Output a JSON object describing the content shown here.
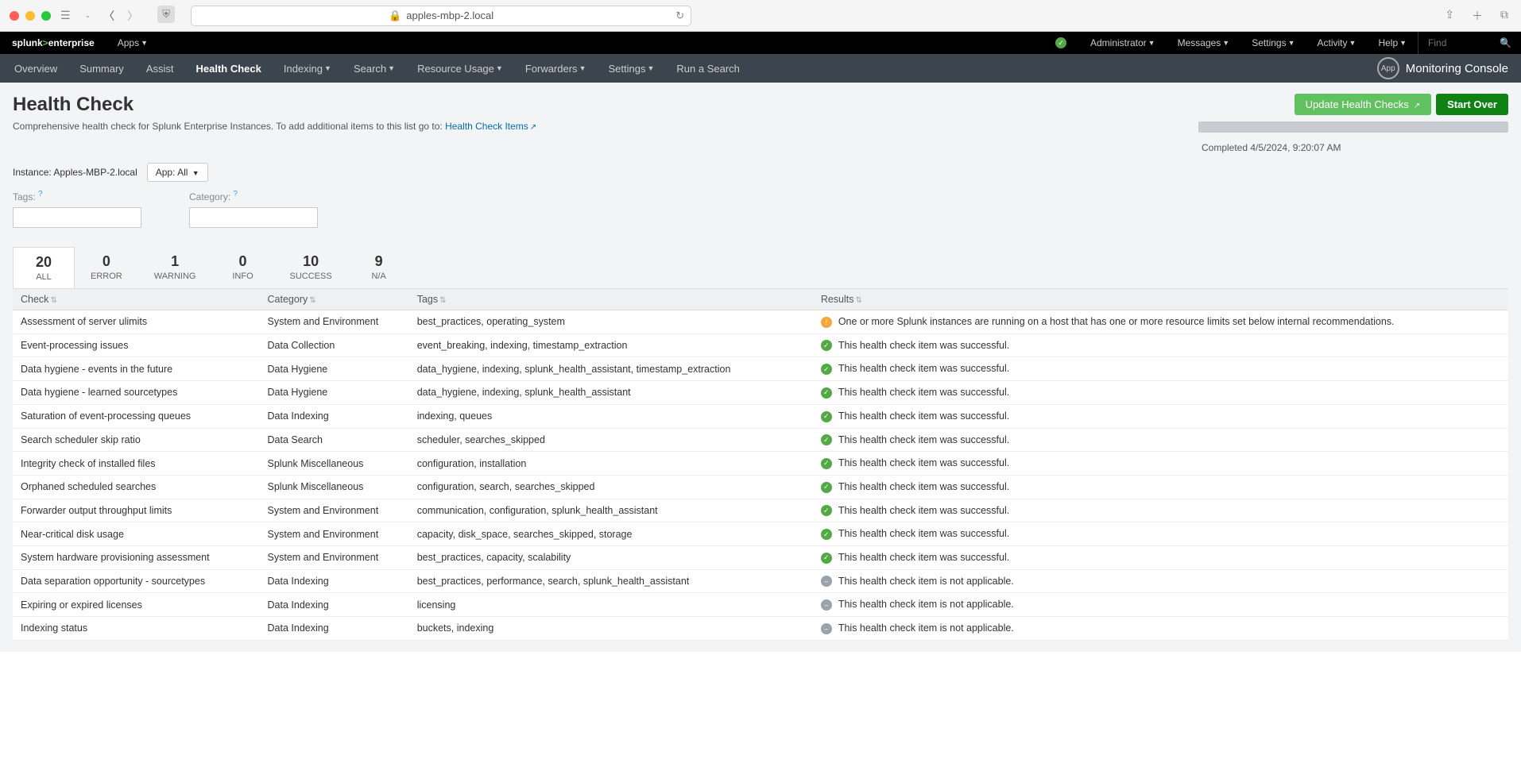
{
  "browser": {
    "url": "apples-mbp-2.local"
  },
  "splunk": {
    "logo_prefix": "splunk",
    "logo_suffix": "enterprise",
    "apps": "Apps",
    "menu": {
      "administrator": "Administrator",
      "messages": "Messages",
      "settings": "Settings",
      "activity": "Activity",
      "help": "Help"
    },
    "find_placeholder": "Find"
  },
  "appnav": {
    "overview": "Overview",
    "summary": "Summary",
    "assist": "Assist",
    "health_check": "Health Check",
    "indexing": "Indexing",
    "search": "Search",
    "resource_usage": "Resource Usage",
    "forwarders": "Forwarders",
    "settings": "Settings",
    "run_search": "Run a Search",
    "app_badge": "App",
    "app_title": "Monitoring Console"
  },
  "page": {
    "title": "Health Check",
    "desc_prefix": "Comprehensive health check for Splunk Enterprise Instances. To add additional items to this list go to: ",
    "desc_link": "Health Check Items",
    "instance_label": "Instance: ",
    "instance_value": "Apples-MBP-2.local",
    "app_filter": "App: All",
    "tags_label": "Tags:",
    "category_label": "Category:",
    "update_btn": "Update Health Checks",
    "start_btn": "Start Over",
    "completed": "Completed 4/5/2024, 9:20:07 AM"
  },
  "summary": [
    {
      "count": "20",
      "label": "ALL"
    },
    {
      "count": "0",
      "label": "ERROR"
    },
    {
      "count": "1",
      "label": "WARNING"
    },
    {
      "count": "0",
      "label": "INFO"
    },
    {
      "count": "10",
      "label": "SUCCESS"
    },
    {
      "count": "9",
      "label": "N/A"
    }
  ],
  "table": {
    "headers": {
      "check": "Check",
      "category": "Category",
      "tags": "Tags",
      "results": "Results"
    },
    "rows": [
      {
        "check": "Assessment of server ulimits",
        "category": "System and Environment",
        "tags": "best_practices, operating_system",
        "status": "warn",
        "result": "One or more Splunk instances are running on a host that has one or more resource limits set below internal recommendations."
      },
      {
        "check": "Event-processing issues",
        "category": "Data Collection",
        "tags": "event_breaking, indexing, timestamp_extraction",
        "status": "ok",
        "result": "This health check item was successful."
      },
      {
        "check": "Data hygiene - events in the future",
        "category": "Data Hygiene",
        "tags": "data_hygiene, indexing, splunk_health_assistant, timestamp_extraction",
        "status": "ok",
        "result": "This health check item was successful."
      },
      {
        "check": "Data hygiene - learned sourcetypes",
        "category": "Data Hygiene",
        "tags": "data_hygiene, indexing, splunk_health_assistant",
        "status": "ok",
        "result": "This health check item was successful."
      },
      {
        "check": "Saturation of event-processing queues",
        "category": "Data Indexing",
        "tags": "indexing, queues",
        "status": "ok",
        "result": "This health check item was successful."
      },
      {
        "check": "Search scheduler skip ratio",
        "category": "Data Search",
        "tags": "scheduler, searches_skipped",
        "status": "ok",
        "result": "This health check item was successful."
      },
      {
        "check": "Integrity check of installed files",
        "category": "Splunk Miscellaneous",
        "tags": "configuration, installation",
        "status": "ok",
        "result": "This health check item was successful."
      },
      {
        "check": "Orphaned scheduled searches",
        "category": "Splunk Miscellaneous",
        "tags": "configuration, search, searches_skipped",
        "status": "ok",
        "result": "This health check item was successful."
      },
      {
        "check": "Forwarder output throughput limits",
        "category": "System and Environment",
        "tags": "communication, configuration, splunk_health_assistant",
        "status": "ok",
        "result": "This health check item was successful."
      },
      {
        "check": "Near-critical disk usage",
        "category": "System and Environment",
        "tags": "capacity, disk_space, searches_skipped, storage",
        "status": "ok",
        "result": "This health check item was successful."
      },
      {
        "check": "System hardware provisioning assessment",
        "category": "System and Environment",
        "tags": "best_practices, capacity, scalability",
        "status": "ok",
        "result": "This health check item was successful."
      },
      {
        "check": "Data separation opportunity - sourcetypes",
        "category": "Data Indexing",
        "tags": "best_practices, performance, search, splunk_health_assistant",
        "status": "na",
        "result": "This health check item is not applicable."
      },
      {
        "check": "Expiring or expired licenses",
        "category": "Data Indexing",
        "tags": "licensing",
        "status": "na",
        "result": "This health check item is not applicable."
      },
      {
        "check": "Indexing status",
        "category": "Data Indexing",
        "tags": "buckets, indexing",
        "status": "na",
        "result": "This health check item is not applicable."
      }
    ]
  }
}
